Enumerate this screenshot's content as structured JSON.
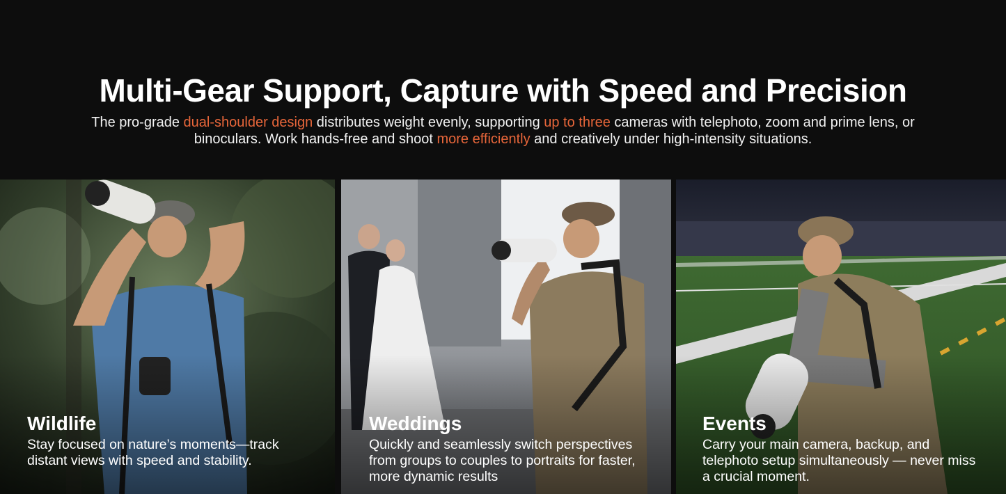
{
  "header": {
    "title": "Multi-Gear Support, Capture with Speed and Precision",
    "subtitle": {
      "p1": "The pro-grade ",
      "h1": "dual-shoulder design",
      "p2": " distributes weight evenly, supporting ",
      "h2": "up to three",
      "p3": " cameras with telephoto, zoom and prime lens, or binoculars. Work hands-free and shoot ",
      "h3": "more efficiently",
      "p4": " and creatively under high-intensity situations."
    }
  },
  "colors": {
    "background": "#0d0d0d",
    "accent": "#e8663a",
    "text": "#ffffff"
  },
  "panels": [
    {
      "title": "Wildlife",
      "text": "Stay focused on nature’s moments—track distant views with speed and stability.",
      "image": "photographer-in-forest-with-telephoto-lens"
    },
    {
      "title": "Weddings",
      "text": "Quickly and seamlessly switch perspectives from groups to couples to portraits for faster, more dynamic results",
      "image": "photographer-at-wedding-with-couple-in-background"
    },
    {
      "title": "Events",
      "text": "Carry your main camera, backup, and telephoto setup simultaneously — never miss a crucial moment.",
      "image": "photographer-kneeling-on-football-field"
    }
  ]
}
